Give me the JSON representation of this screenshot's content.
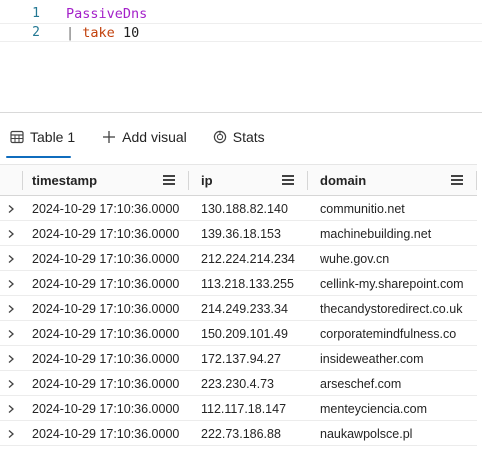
{
  "editor": {
    "lines": [
      {
        "number": "1",
        "table": "PassiveDns"
      },
      {
        "number": "2",
        "pipe": "|",
        "keyword": "take",
        "value": "10"
      }
    ]
  },
  "tabs": {
    "table_label": "Table 1",
    "add_visual_label": "Add visual",
    "stats_label": "Stats"
  },
  "grid": {
    "columns": [
      "timestamp",
      "ip",
      "domain"
    ],
    "rows": [
      [
        "2024-10-29 17:10:36.0000",
        "130.188.82.140",
        "communitio.net"
      ],
      [
        "2024-10-29 17:10:36.0000",
        "139.36.18.153",
        "machinebuilding.net"
      ],
      [
        "2024-10-29 17:10:36.0000",
        "212.224.214.234",
        "wuhe.gov.cn"
      ],
      [
        "2024-10-29 17:10:36.0000",
        "113.218.133.255",
        "cellink-my.sharepoint.com"
      ],
      [
        "2024-10-29 17:10:36.0000",
        "214.249.233.34",
        "thecandystoredirect.co.uk"
      ],
      [
        "2024-10-29 17:10:36.0000",
        "150.209.101.49",
        "corporatemindfulness.co"
      ],
      [
        "2024-10-29 17:10:36.0000",
        "172.137.94.27",
        "insideweather.com"
      ],
      [
        "2024-10-29 17:10:36.0000",
        "223.230.4.73",
        "arseschef.com"
      ],
      [
        "2024-10-29 17:10:36.0000",
        "112.117.18.147",
        "menteyciencia.com"
      ],
      [
        "2024-10-29 17:10:36.0000",
        "222.73.186.88",
        "naukawpolsce.pl"
      ]
    ]
  },
  "colors": {
    "accent": "#0f6cbd",
    "table_token": "#a31fc9",
    "keyword_token": "#c2410c",
    "line_number": "#237893"
  }
}
